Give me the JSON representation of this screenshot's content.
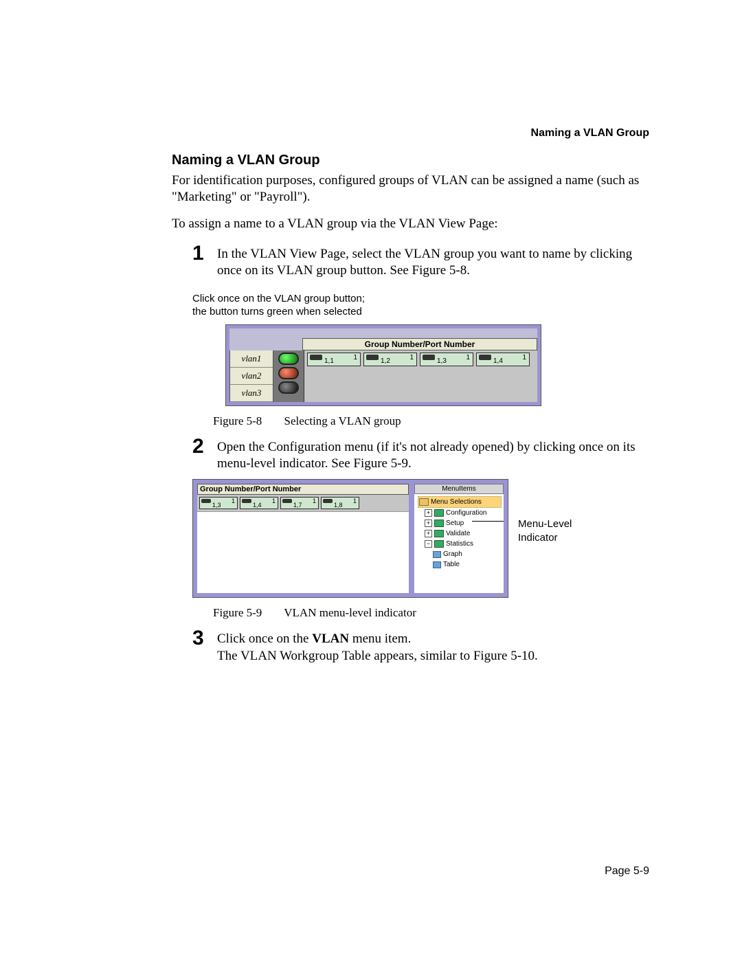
{
  "header": {
    "running_title": "Naming a VLAN Group"
  },
  "section": {
    "heading": "Naming a VLAN Group"
  },
  "paragraphs": {
    "intro": "For identification purposes, configured groups of VLAN can be assigned a name (such as \"Marketing\" or \"Payroll\").",
    "lead_in": "To assign a name to a VLAN group via the VLAN View Page:"
  },
  "steps": {
    "s1": {
      "num": "1",
      "text": "In the VLAN View Page, select the VLAN group you want to name by clicking once on its VLAN group button.  See Figure 5-8."
    },
    "s2": {
      "num": "2",
      "text": "Open the Configuration menu (if it's not already opened) by clicking once on its menu-level indicator.  See Figure 5-9."
    },
    "s3": {
      "num": "3",
      "text_a": "Click once on the ",
      "bold": "VLAN",
      "text_b": " menu item.",
      "text_c": "The VLAN Workgroup Table appears, similar to Figure 5-10."
    }
  },
  "fig58": {
    "note_line1": "Click once on the VLAN group button;",
    "note_line2": "the button turns green when selected",
    "header": "Group Number/Port Number",
    "vlans": [
      "vlan1",
      "vlan2",
      "vlan3"
    ],
    "ports": [
      {
        "top": "1",
        "sub": "1,1"
      },
      {
        "top": "1",
        "sub": "1,2"
      },
      {
        "top": "1",
        "sub": "1,3"
      },
      {
        "top": "1",
        "sub": "1,4"
      }
    ],
    "caption_label": "Figure 5-8",
    "caption_text": "Selecting a VLAN group"
  },
  "fig59": {
    "header": "Group Number/Port Number",
    "ports": [
      {
        "top": "1",
        "sub": "1,3"
      },
      {
        "top": "1",
        "sub": "1,4"
      },
      {
        "top": "1",
        "sub": "1,7"
      },
      {
        "top": "1",
        "sub": "1,8"
      }
    ],
    "menu_header": "MenuItems",
    "tree": {
      "root": "Menu Selections",
      "items": [
        {
          "label": "Configuration",
          "exp": "+"
        },
        {
          "label": "Setup",
          "exp": "+"
        },
        {
          "label": "Validate",
          "exp": "+"
        },
        {
          "label": "Statistics",
          "exp": "−",
          "children": [
            "Graph",
            "Table"
          ]
        }
      ]
    },
    "callout_label1": "Menu-Level",
    "callout_label2": "Indicator",
    "caption_label": "Figure 5-9",
    "caption_text": "VLAN menu-level indicator"
  },
  "footer": {
    "page_number": "Page 5-9"
  }
}
